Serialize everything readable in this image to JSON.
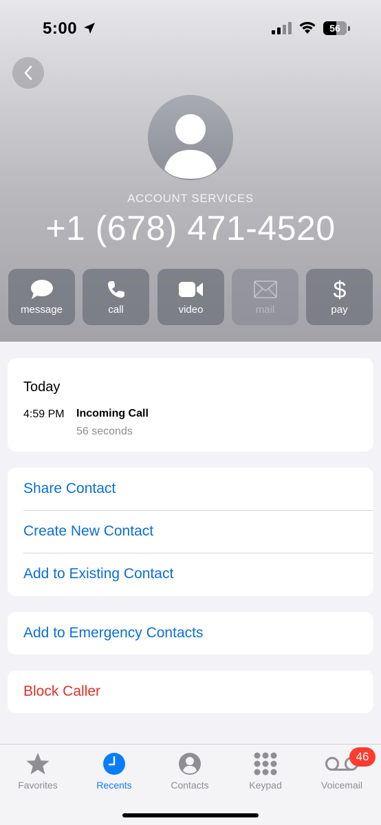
{
  "status_bar": {
    "time": "5:00",
    "battery": "56",
    "battery_level": 0.56
  },
  "contact": {
    "label": "ACCOUNT SERVICES",
    "phone": "+1 (678) 471-4520"
  },
  "actions": [
    {
      "label": "message",
      "icon": "message-icon",
      "enabled": true
    },
    {
      "label": "call",
      "icon": "phone-icon",
      "enabled": true
    },
    {
      "label": "video",
      "icon": "video-icon",
      "enabled": true
    },
    {
      "label": "mail",
      "icon": "mail-icon",
      "enabled": false
    },
    {
      "label": "pay",
      "icon": "dollar-icon",
      "enabled": true
    }
  ],
  "history": {
    "day": "Today",
    "entries": [
      {
        "time": "4:59 PM",
        "type": "Incoming Call",
        "duration": "56 seconds"
      }
    ]
  },
  "options": {
    "share": "Share Contact",
    "create": "Create New Contact",
    "add_existing": "Add to Existing Contact",
    "emergency": "Add to Emergency Contacts",
    "block": "Block Caller"
  },
  "colors": {
    "link": "#0a6fd6",
    "destructive": "#e0312a",
    "active_tab": "#0a7cff",
    "badge": "#ff3b30"
  },
  "tabs": [
    {
      "label": "Favorites",
      "icon": "star-icon",
      "active": false
    },
    {
      "label": "Recents",
      "icon": "clock-icon",
      "active": true
    },
    {
      "label": "Contacts",
      "icon": "person-circle-icon",
      "active": false
    },
    {
      "label": "Keypad",
      "icon": "keypad-icon",
      "active": false
    },
    {
      "label": "Voicemail",
      "icon": "voicemail-icon",
      "active": false,
      "badge": "46"
    }
  ]
}
